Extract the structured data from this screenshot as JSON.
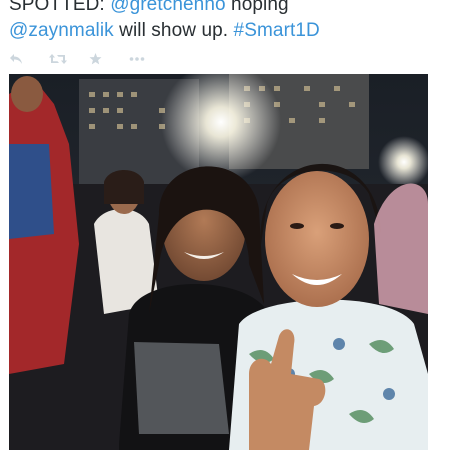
{
  "tweet": {
    "text_prefix": "SPOTTED: ",
    "mention_1": "@gretchenho",
    "text_middle_1": " hoping",
    "mention_2": "@zaynmalik",
    "text_middle_2": " will show up. ",
    "hashtag": "#Smart1D"
  },
  "actions": {
    "icons": [
      "reply-icon",
      "retweet-icon",
      "favorite-icon",
      "more-icon"
    ],
    "color": "#ccd6dd"
  },
  "photo": {
    "subject": "night-concert-selfie"
  },
  "colors": {
    "text": "#292f33",
    "link": "#3b94d9",
    "icon": "#ccd6dd"
  }
}
